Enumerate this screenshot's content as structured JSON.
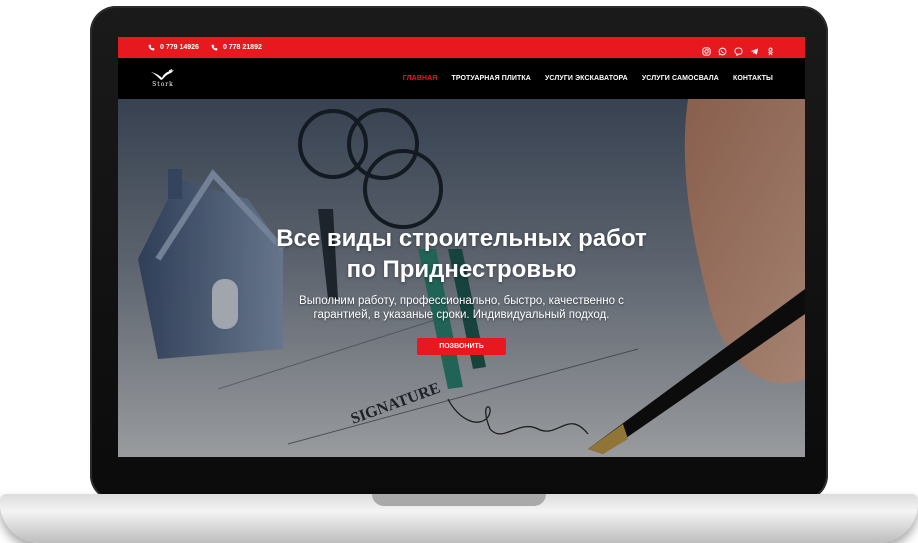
{
  "topbar": {
    "phones": [
      "0 779 14926",
      "0 778 21892"
    ],
    "socials": [
      "instagram-icon",
      "whatsapp-icon",
      "viber-icon",
      "telegram-icon",
      "odnoklassniki-icon"
    ],
    "bg_color": "#e8181f"
  },
  "nav": {
    "logo_text": "Stork",
    "items": [
      {
        "label": "ГЛАВНАЯ",
        "active": true
      },
      {
        "label": "ТРОТУАРНАЯ ПЛИТКА",
        "active": false
      },
      {
        "label": "УСЛУГИ ЭКСКАВАТОРА",
        "active": false
      },
      {
        "label": "УСЛУГИ САМОСВАЛА",
        "active": false
      },
      {
        "label": "КОНТАКТЫ",
        "active": false
      }
    ]
  },
  "hero": {
    "title_line1": "Все виды строительных работ",
    "title_line2": "по Приднестровью",
    "sub_line1": "Выполним работу, профессионально, быстро, качественно с",
    "sub_line2": "гарантией, в указаные сроки. Индивидуальный подход.",
    "cta_label": "ПОЗВОНИТЬ",
    "photo_text": "SIGNATURE"
  }
}
